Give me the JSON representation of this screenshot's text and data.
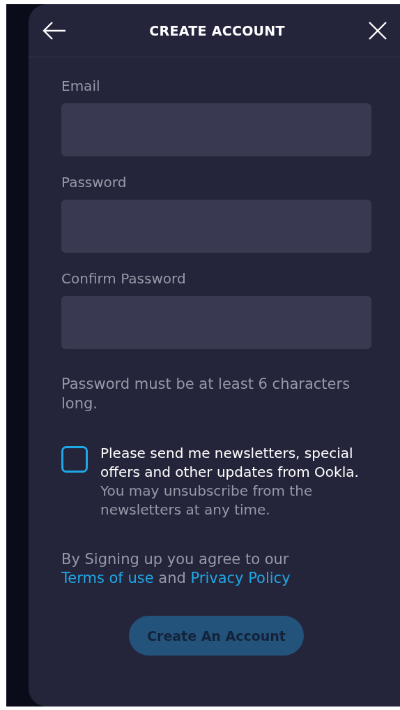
{
  "header": {
    "title": "CREATE ACCOUNT"
  },
  "fields": [
    {
      "label": "Email"
    },
    {
      "label": "Password"
    },
    {
      "label": "Confirm Password"
    }
  ],
  "hint": "Password must be at least 6 characters long.",
  "newsletter": {
    "checked": false,
    "label": "**Please send me newsletters, special offers and other updates from Ookla.** You may unsubscribe from the newsletters at any time."
  },
  "legal": [
    {
      "kind": "text",
      "text": "By Signing up you agree to our "
    },
    {
      "kind": "link",
      "text": "Terms of use"
    },
    {
      "kind": "text",
      "text": " and "
    },
    {
      "kind": "link",
      "text": "Privacy Policy"
    }
  ],
  "submit": {
    "label": "Create An Account",
    "disabled": true
  }
}
